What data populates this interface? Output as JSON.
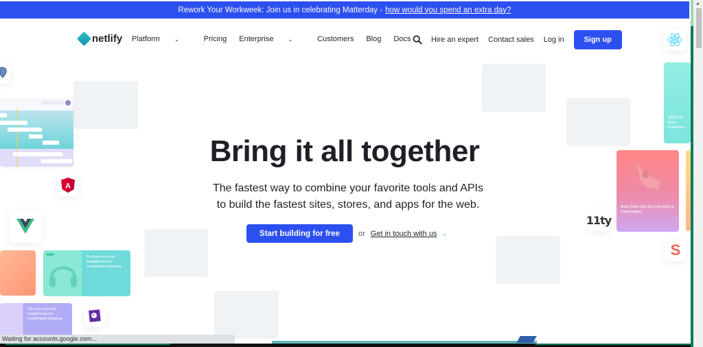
{
  "announcement": {
    "text": "Rework Your Workweek: Join us in celebrating Matterday -",
    "link": "how would you spend an extra day?"
  },
  "nav": {
    "logo": "netlify",
    "links": [
      {
        "label": "Platform",
        "dropdown": true
      },
      {
        "label": "Pricing",
        "dropdown": false
      },
      {
        "label": "Enterprise",
        "dropdown": true
      },
      {
        "label": "Customers",
        "dropdown": false
      },
      {
        "label": "Blog",
        "dropdown": false
      },
      {
        "label": "Docs",
        "dropdown": false
      }
    ],
    "right": {
      "search_icon": "search-icon",
      "hire": "Hire an expert",
      "contact": "Contact sales",
      "login": "Log in",
      "signup": "Sign up"
    }
  },
  "hero": {
    "title": "Bring it all together",
    "subtitle_line1": "The fastest way to combine your favorite tools and APIs",
    "subtitle_line2": "to build the fastest sites, stores, and apps for the web.",
    "cta_primary": "Start building for free",
    "cta_or": "or",
    "cta_secondary": "Get in touch with us",
    "cta_arrow": "→"
  },
  "integrations": {
    "react": "React",
    "angular": "A",
    "vue": "Vue",
    "eleventy": "11ty",
    "sanity": "S",
    "postgres": "PostgreSQL",
    "datadog": "Datadog"
  },
  "cards": {
    "headphones_title": "The best over-ear headphones for comfortable listening",
    "watercolor_title": "Wear Color Like the Cool Kids of Copenhagen",
    "foil_title": "Q&Q Foil Rose Collection"
  },
  "status_bar": {
    "text": "Waiting for accounts.google.com..."
  },
  "colors": {
    "brand_blue": "#2c4ff0",
    "teal": "#30c1c1",
    "text": "#1d2026"
  }
}
